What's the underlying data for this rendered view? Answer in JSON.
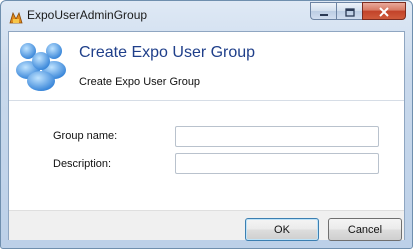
{
  "window": {
    "title": "ExpoUserAdminGroup",
    "controls": {
      "minimize": "minimize-icon",
      "maximize": "maximize-icon",
      "close": "close-icon"
    }
  },
  "header": {
    "title": "Create Expo User Group",
    "subtitle": "Create Expo User Group",
    "icon": "users-group-icon"
  },
  "form": {
    "group_name_label": "Group name:",
    "group_name_value": "",
    "description_label": "Description:",
    "description_value": ""
  },
  "buttons": {
    "ok": "OK",
    "cancel": "Cancel"
  },
  "colors": {
    "header_title": "#1f3f8a",
    "frame": "#bcd0e8",
    "close": "#c2432a"
  }
}
